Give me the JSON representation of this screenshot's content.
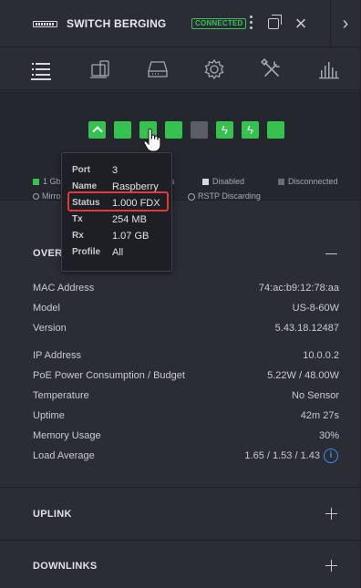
{
  "window": {
    "title": "SWITCH BERGING",
    "status_badge": "CONNECTED",
    "device_icon": "switch-device-icon"
  },
  "toolbar": {
    "tabs": [
      {
        "icon": "list-icon"
      },
      {
        "icon": "devices-icon"
      },
      {
        "icon": "drive-icon"
      },
      {
        "icon": "gear-icon"
      },
      {
        "icon": "tools-icon"
      },
      {
        "icon": "stats-icon"
      }
    ]
  },
  "ports": [
    {
      "number": 1,
      "state": "uplink"
    },
    {
      "number": 2,
      "state": "connected"
    },
    {
      "number": 3,
      "state": "connected"
    },
    {
      "number": 4,
      "state": "connected"
    },
    {
      "number": 5,
      "state": "disabled"
    },
    {
      "number": 6,
      "state": "poe"
    },
    {
      "number": 7,
      "state": "poe"
    },
    {
      "number": 8,
      "state": "connected"
    }
  ],
  "legend": {
    "gbps": "1 Gbps",
    "gbps_tail": "s",
    "disabled": "Disabled",
    "disconnected": "Disconnected",
    "mirror": "Mirro",
    "rstp": "RSTP Discarding"
  },
  "tooltip": {
    "port_label": "Port",
    "port_value": "3",
    "name_label": "Name",
    "name_value": "Raspberry",
    "status_label": "Status",
    "status_value": "1.000 FDX",
    "tx_label": "Tx",
    "tx_value": "254 MB",
    "rx_label": "Rx",
    "rx_value": "1.07 GB",
    "profile_label": "Profile",
    "profile_value": "All"
  },
  "overview": {
    "title": "OVER",
    "rows1": [
      {
        "label": "MAC Address",
        "value": "74:ac:b9:12:78:aa"
      },
      {
        "label": "Model",
        "value": "US-8-60W"
      },
      {
        "label": "Version",
        "value": "5.43.18.12487"
      }
    ],
    "rows2": [
      {
        "label": "IP Address",
        "value": "10.0.0.2"
      },
      {
        "label": "PoE Power Consumption / Budget",
        "value": "5.22W / 48.00W"
      },
      {
        "label": "Temperature",
        "value": "No Sensor"
      },
      {
        "label": "Uptime",
        "value": "42m 27s"
      },
      {
        "label": "Memory Usage",
        "value": "30%"
      },
      {
        "label": "Load Average",
        "value": "1.65 / 1.53 / 1.43"
      }
    ]
  },
  "sections": {
    "uplink": "UPLINK",
    "downlinks": "DOWNLINKS"
  },
  "colors": {
    "port_connected": "#35c24e",
    "port_disabled": "#5c5e66",
    "badge": "#3fbf5a",
    "highlight": "#e23a3a",
    "info": "#3b8bff"
  }
}
